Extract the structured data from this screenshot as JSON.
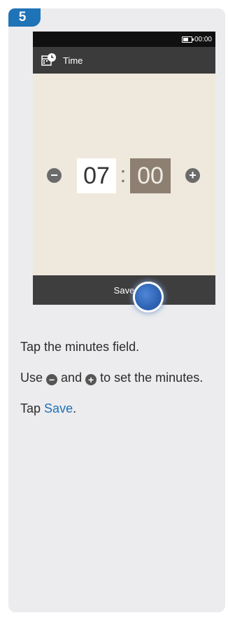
{
  "step": {
    "number": "5"
  },
  "status_bar": {
    "clock": "00:00",
    "battery_icon": "battery-icon"
  },
  "title_bar": {
    "title": "Time",
    "icon": "calendar-clock-icon"
  },
  "time_picker": {
    "hours": "07",
    "separator": ":",
    "minutes": "00",
    "minus_icon": "minus-icon",
    "plus_icon": "plus-icon"
  },
  "bottom_bar": {
    "save_label": "Save"
  },
  "instructions": {
    "line1": "Tap the minutes field.",
    "line2_a": "Use",
    "line2_b": "and",
    "line2_c": "to set the minutes.",
    "line3_a": "Tap",
    "line3_link": "Save",
    "line3_b": "."
  },
  "colors": {
    "badge": "#1f73b7",
    "link": "#1f6fb8",
    "minutes_field": "#8d8072",
    "tap_indicator": "#2e63b4"
  }
}
